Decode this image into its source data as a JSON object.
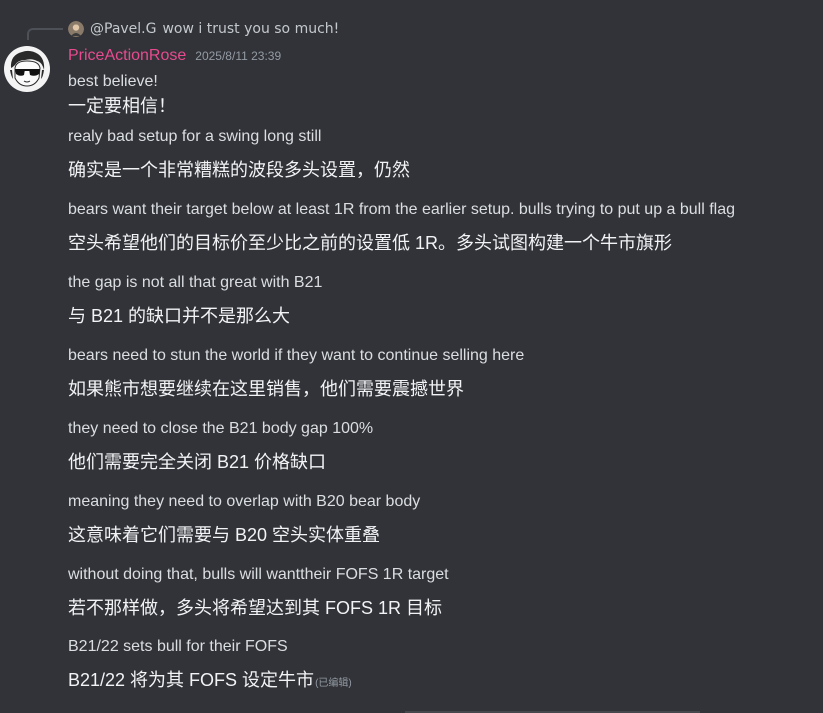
{
  "reply": {
    "author": "@Pavel.G",
    "text": "wow i trust you so much!"
  },
  "message": {
    "author": "PriceActionRose",
    "timestamp": "2025/8/11 23:39",
    "author_color": "#e84a8f",
    "lines": [
      "best believe!",
      "一定要相信！",
      "realy bad setup for a swing long  still",
      "确实是一个非常糟糕的波段多头设置，仍然",
      "bears want their target below at least 1R from the earlier setup. bulls trying to put up a bull flag",
      "空头希望他们的目标价至少比之前的设置低 1R。多头试图构建一个牛市旗形",
      "the gap is not all that great with B21",
      "与 B21 的缺口并不是那么大",
      "bears need to stun the world if they want to continue selling here",
      "如果熊市想要继续在这里销售，他们需要震撼世界",
      "they need to close the B21 body gap 100%",
      "他们需要完全关闭 B21 价格缺口",
      "meaning they need to overlap with B20 bear body",
      "这意味着它们需要与 B20 空头实体重叠",
      "without doing that, bulls will wanttheir FOFS 1R target",
      "若不那样做，多头将希望达到其 FOFS 1R 目标",
      "B21/22 sets bull for their FOFS",
      "B21/22 将为其 FOFS 设定牛市"
    ],
    "edited_label": "(已编辑)"
  },
  "icons": {
    "reply_avatar": "user-avatar-icon",
    "author_avatar": "sunglasses-avatar-icon"
  },
  "colors": {
    "background": "#313338",
    "text": "#dbdee1",
    "muted": "#949ba4"
  }
}
